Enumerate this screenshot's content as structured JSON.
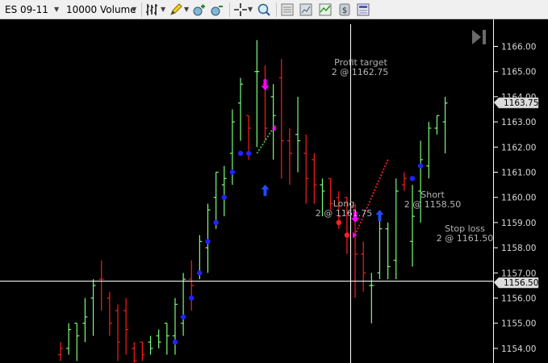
{
  "toolbar": {
    "instrument": "ES 09-11",
    "period": "10000 Volume",
    "icons": [
      "bar-type-icon",
      "drawing-pencil-icon",
      "zoom-in-icon",
      "zoom-out-icon",
      "crosshair-icon",
      "magnifier-icon",
      "data-box-icon",
      "chart-properties-icon",
      "indicators-icon",
      "strategies-icon",
      "chart-trader-icon"
    ]
  },
  "chart": {
    "colors": {
      "up": "#7CFC7C",
      "down": "#FF1A1A",
      "dots_up": "#2222FF",
      "dots_down": "#FF2020",
      "axis": "#ffffff",
      "crosshair": "#ffffff",
      "long_arrow": "#1E4BFF",
      "short_arrow": "#FF00FF"
    },
    "y_ticks": [
      "1166.00",
      "1165.00",
      "1164.00",
      "1163.00",
      "1162.00",
      "1161.00",
      "1160.00",
      "1159.00",
      "1158.00",
      "1157.00",
      "1156.00",
      "1155.00",
      "1154.00"
    ],
    "last_price_label": "1163.75",
    "crosshair_price_label": "1156.50",
    "annotations": {
      "profit_target": {
        "title": "Profit target",
        "detail": "2 @ 1162.75"
      },
      "long": {
        "title": "Long",
        "detail": "2 @ 1161.75"
      },
      "short": {
        "title": "Short",
        "detail": "2 @ 1158.50"
      },
      "stop_loss": {
        "title": "Stop loss",
        "detail": "2 @ 1161.50"
      }
    },
    "bars": [
      {
        "o": 1153.75,
        "h": 1154.25,
        "c": 1154.0,
        "l": 1153.5,
        "d": "down"
      },
      {
        "o": 1154.0,
        "h": 1155.0,
        "c": 1154.75,
        "l": 1153.75,
        "d": "up"
      },
      {
        "o": 1155.0,
        "h": 1154.75,
        "c": 1154.5,
        "l": 1153.5,
        "d": "up"
      },
      {
        "o": 1155.0,
        "h": 1156.0,
        "c": 1155.25,
        "l": 1154.25,
        "d": "up"
      },
      {
        "o": 1156.0,
        "h": 1156.75,
        "c": 1156.5,
        "l": 1154.5,
        "d": "up"
      },
      {
        "o": 1156.75,
        "h": 1157.5,
        "c": 1156.75,
        "l": 1155.5,
        "d": "down"
      },
      {
        "o": 1156.0,
        "h": 1156.25,
        "c": 1155.0,
        "l": 1154.5,
        "d": "down"
      },
      {
        "o": 1155.5,
        "h": 1155.75,
        "c": 1154.25,
        "l": 1153.5,
        "d": "down"
      },
      {
        "o": 1155.5,
        "h": 1156.0,
        "c": 1154.75,
        "l": 1153.75,
        "d": "down"
      },
      {
        "o": 1154.0,
        "h": 1154.25,
        "c": 1153.5,
        "l": 1153.25,
        "d": "down"
      },
      {
        "o": 1154.25,
        "h": 1154.25,
        "c": 1153.75,
        "l": 1153.5,
        "d": "down"
      },
      {
        "o": 1154.25,
        "h": 1154.5,
        "c": 1154.0,
        "l": 1153.75,
        "d": "up"
      },
      {
        "o": 1154.5,
        "h": 1154.75,
        "c": 1154.25,
        "l": 1154.0,
        "d": "up"
      },
      {
        "o": 1155.0,
        "h": 1154.75,
        "c": 1154.5,
        "l": 1153.75,
        "d": "up"
      },
      {
        "o": 1154.5,
        "h": 1156.0,
        "c": 1155.75,
        "l": 1153.75,
        "d": "up"
      },
      {
        "o": 1155.0,
        "h": 1157.0,
        "c": 1156.75,
        "l": 1154.5,
        "d": "up"
      },
      {
        "o": 1156.75,
        "h": 1157.5,
        "c": 1156.5,
        "l": 1155.5,
        "d": "down"
      },
      {
        "o": 1157.0,
        "h": 1158.5,
        "c": 1158.25,
        "l": 1156.75,
        "d": "up"
      },
      {
        "o": 1158.0,
        "h": 1159.75,
        "c": 1159.5,
        "l": 1157.0,
        "d": "up"
      },
      {
        "o": 1160.0,
        "h": 1161.0,
        "c": 1161.0,
        "l": 1158.75,
        "d": "up"
      },
      {
        "o": 1160.5,
        "h": 1161.25,
        "c": 1160.75,
        "l": 1159.25,
        "d": "up"
      },
      {
        "o": 1161.75,
        "h": 1163.5,
        "c": 1163.0,
        "l": 1160.5,
        "d": "up"
      },
      {
        "o": 1163.75,
        "h": 1164.75,
        "c": 1164.5,
        "l": 1162.25,
        "d": "up"
      },
      {
        "o": 1163.25,
        "h": 1163.25,
        "c": 1162.75,
        "l": 1161.5,
        "d": "down"
      },
      {
        "o": 1165.0,
        "h": 1166.25,
        "c": 1165.0,
        "l": 1162.0,
        "d": "up"
      },
      {
        "o": 1164.5,
        "h": 1165.25,
        "c": 1162.75,
        "l": 1162.25,
        "d": "down"
      },
      {
        "o": 1164.0,
        "h": 1164.5,
        "c": 1163.25,
        "l": 1161.5,
        "d": "up"
      },
      {
        "o": 1164.75,
        "h": 1165.5,
        "c": 1162.25,
        "l": 1160.75,
        "d": "down"
      },
      {
        "o": 1162.25,
        "h": 1162.75,
        "c": 1161.75,
        "l": 1160.5,
        "d": "down"
      },
      {
        "o": 1162.5,
        "h": 1164.0,
        "c": 1162.25,
        "l": 1161.0,
        "d": "up"
      },
      {
        "o": 1161.75,
        "h": 1162.5,
        "c": 1160.75,
        "l": 1159.75,
        "d": "down"
      },
      {
        "o": 1161.5,
        "h": 1161.75,
        "c": 1160.5,
        "l": 1159.75,
        "d": "down"
      },
      {
        "o": 1160.5,
        "h": 1160.75,
        "c": 1160.25,
        "l": 1159.25,
        "d": "up"
      },
      {
        "o": 1160.75,
        "h": 1160.75,
        "c": 1159.75,
        "l": 1159.5,
        "d": "down"
      },
      {
        "o": 1160.0,
        "h": 1160.25,
        "c": 1159.25,
        "l": 1158.75,
        "d": "down"
      },
      {
        "o": 1160.0,
        "h": 1160.0,
        "c": 1158.5,
        "l": 1157.75,
        "d": "down"
      },
      {
        "o": 1159.5,
        "h": 1159.75,
        "c": 1157.75,
        "l": 1156.0,
        "d": "down"
      },
      {
        "o": 1157.75,
        "h": 1158.25,
        "c": 1157.0,
        "l": 1156.25,
        "d": "down"
      },
      {
        "o": 1156.5,
        "h": 1157.0,
        "c": 1156.5,
        "l": 1155.0,
        "d": "up"
      },
      {
        "o": 1157.0,
        "h": 1159.25,
        "c": 1158.75,
        "l": 1156.75,
        "d": "up"
      },
      {
        "o": 1158.75,
        "h": 1159.0,
        "c": 1157.25,
        "l": 1156.75,
        "d": "up"
      },
      {
        "o": 1157.5,
        "h": 1160.75,
        "c": 1160.25,
        "l": 1156.75,
        "d": "up"
      },
      {
        "o": 1160.5,
        "h": 1161.0,
        "c": 1160.75,
        "l": 1160.25,
        "d": "down"
      },
      {
        "o": 1158.25,
        "h": 1160.5,
        "c": 1159.25,
        "l": 1157.25,
        "d": "up"
      },
      {
        "o": 1160.25,
        "h": 1162.25,
        "c": 1161.5,
        "l": 1159.0,
        "d": "up"
      },
      {
        "o": 1161.25,
        "h": 1163.0,
        "c": 1162.75,
        "l": 1160.75,
        "d": "up"
      },
      {
        "o": 1162.75,
        "h": 1163.25,
        "c": 1163.25,
        "l": 1162.5,
        "d": "up"
      },
      {
        "o": 1163.0,
        "h": 1164.0,
        "c": 1163.75,
        "l": 1161.75,
        "d": "up"
      }
    ],
    "psar": [
      {
        "i": 14,
        "v": 1154.25,
        "c": "blue"
      },
      {
        "i": 15,
        "v": 1155.25,
        "c": "blue"
      },
      {
        "i": 16,
        "v": 1156.0,
        "c": "blue"
      },
      {
        "i": 17,
        "v": 1157.0,
        "c": "blue"
      },
      {
        "i": 18,
        "v": 1158.25,
        "c": "blue"
      },
      {
        "i": 19,
        "v": 1159.0,
        "c": "blue"
      },
      {
        "i": 20,
        "v": 1160.0,
        "c": "blue"
      },
      {
        "i": 21,
        "v": 1161.0,
        "c": "blue"
      },
      {
        "i": 22,
        "v": 1161.75,
        "c": "blue"
      },
      {
        "i": 23,
        "v": 1161.75,
        "c": "blue"
      },
      {
        "i": 34,
        "v": 1159.0,
        "c": "red"
      },
      {
        "i": 35,
        "v": 1158.5,
        "c": "red"
      },
      {
        "i": 43,
        "v": 1160.75,
        "c": "blue"
      },
      {
        "i": 44,
        "v": 1161.25,
        "c": "blue"
      }
    ],
    "trades": [
      {
        "from_i": 24,
        "from_v": 1161.75,
        "to_i": 26,
        "to_v": 1162.75,
        "color": "#3CB043"
      },
      {
        "from_i": 36,
        "from_v": 1158.5,
        "to_i": 40,
        "to_v": 1161.5,
        "color": "#E0202A"
      }
    ],
    "markers": [
      {
        "i": 25,
        "v": 1160.25,
        "dir": "up",
        "color": "long_arrow"
      },
      {
        "i": 25,
        "v": 1164.5,
        "dir": "down",
        "color": "short_arrow"
      },
      {
        "i": 36,
        "v": 1159.25,
        "dir": "down",
        "color": "short_arrow"
      },
      {
        "i": 39,
        "v": 1159.25,
        "dir": "up",
        "color": "long_arrow"
      }
    ]
  }
}
